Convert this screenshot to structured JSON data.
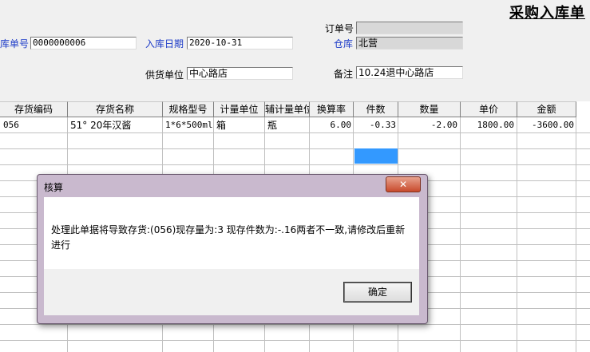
{
  "header": {
    "title": "采购入库单",
    "order_no_label": "订单号",
    "order_no_value": "",
    "doc_no_label": "库单号",
    "doc_no_value": "0000000006",
    "in_date_label": "入库日期",
    "in_date_value": "2020-10-31",
    "warehouse_label": "仓库",
    "warehouse_value": "北营",
    "supplier_label": "供货单位",
    "supplier_value": "中心路店",
    "remark_label": "备注",
    "remark_value": "10.24退中心路店"
  },
  "table": {
    "columns": [
      "存货编码",
      "存货名称",
      "规格型号",
      "计量单位",
      "辅计量单位",
      "换算率",
      "件数",
      "数量",
      "单价",
      "金额"
    ],
    "rows": [
      {
        "code": "056",
        "name": "51° 20年汉酱",
        "spec": "1*6*500ml",
        "unit": "箱",
        "aux_unit": "瓶",
        "rate": "6.00",
        "pieces": "-0.33",
        "qty": "-2.00",
        "price": "1800.00",
        "amount": "-3600.00"
      }
    ]
  },
  "dialog": {
    "title": "核算",
    "close_label": "✕",
    "message": "处理此单据将导致存货:(056)现存量为:3 现存件数为:-.16两者不一致,请修改后重新进行",
    "ok_label": "确定"
  }
}
